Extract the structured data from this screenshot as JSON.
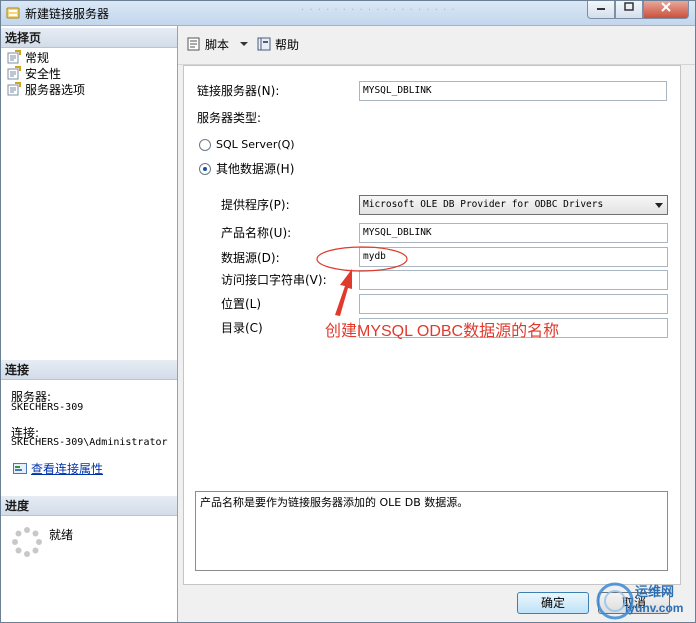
{
  "window": {
    "title": "新建链接服务器"
  },
  "left": {
    "select_page_header": "选择页",
    "pages": [
      {
        "label": "常规",
        "icon": "page-settings-icon"
      },
      {
        "label": "安全性",
        "icon": "page-settings-icon"
      },
      {
        "label": "服务器选项",
        "icon": "page-settings-icon"
      }
    ],
    "connection_header": "连接",
    "server_label": "服务器:",
    "server_value": "SKECHERS-309",
    "connection_label": "连接:",
    "connection_value": "SKECHERS-309\\Administrator",
    "view_props_link": "查看连接属性",
    "progress_header": "进度",
    "progress_status": "就绪"
  },
  "toolbar": {
    "script_label": "脚本",
    "help_label": "帮助"
  },
  "form": {
    "linked_server_label": "链接服务器(N):",
    "linked_server_value": "MYSQL_DBLINK",
    "server_type_label": "服务器类型:",
    "sql_server_label": "SQL Server(Q)",
    "other_source_label": "其他数据源(H)",
    "selected_type": "other",
    "provider_label": "提供程序(P):",
    "provider_value": "Microsoft OLE DB Provider for ODBC Drivers",
    "product_label": "产品名称(U):",
    "product_value": "MYSQL_DBLINK",
    "datasource_label": "数据源(D):",
    "datasource_value": "mydb",
    "provider_string_label": "访问接口字符串(V):",
    "provider_string_value": "",
    "location_label": "位置(L)",
    "location_value": "",
    "catalog_label": "目录(C)",
    "catalog_value": ""
  },
  "description": "产品名称是要作为链接服务器添加的 OLE DB 数据源。",
  "buttons": {
    "ok": "确定",
    "cancel": "取消"
  },
  "annotation": {
    "text": "创建MYSQL ODBC数据源的名称",
    "color": "#e03a2d"
  },
  "watermark": {
    "cn": "运维网",
    "url": "iyunv.com"
  }
}
